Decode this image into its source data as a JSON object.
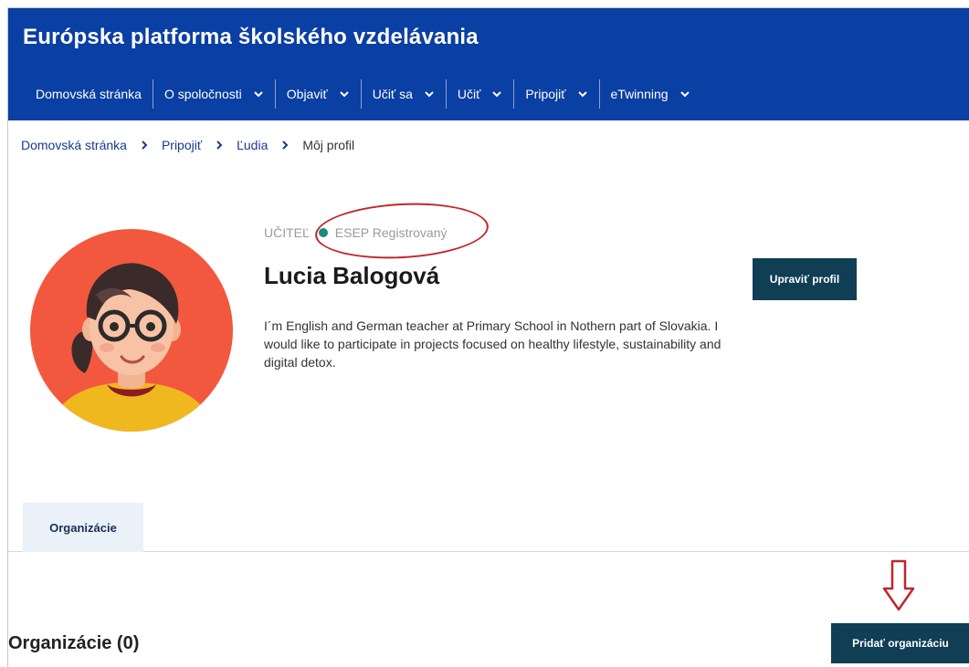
{
  "site": {
    "title": "Európska platforma školského vzdelávania"
  },
  "nav": {
    "items": [
      {
        "label": "Domovská stránka",
        "has_dropdown": false
      },
      {
        "label": "O spoločnosti",
        "has_dropdown": true
      },
      {
        "label": "Objaviť",
        "has_dropdown": true
      },
      {
        "label": "Učiť sa",
        "has_dropdown": true
      },
      {
        "label": "Učiť",
        "has_dropdown": true
      },
      {
        "label": "Pripojiť",
        "has_dropdown": true
      },
      {
        "label": "eTwinning",
        "has_dropdown": true
      }
    ]
  },
  "breadcrumb": {
    "items": [
      "Domovská stránka",
      "Pripojiť",
      "Ľudia"
    ],
    "current": "Môj profil"
  },
  "profile": {
    "role": "UČITEĽ",
    "status": "ESEP Registrovaný",
    "status_color": "#1a8a79",
    "name": "Lucia Balogová",
    "bio": "I´m English and German teacher at Primary School in Nothern part of Slovakia. I would like to participate in projects focused on healthy lifestyle, sustainability and digital detox.",
    "edit_label": "Upraviť profil"
  },
  "tabs": {
    "items": [
      "Organizácie"
    ]
  },
  "organizations": {
    "title": "Organizácie (0)",
    "add_label": "Pridať organizáciu"
  },
  "colors": {
    "header_bg": "#0a3fa3",
    "button_bg": "#0f3e55",
    "annotation_red": "#c0262a",
    "tab_bg": "#eaf1f8"
  }
}
